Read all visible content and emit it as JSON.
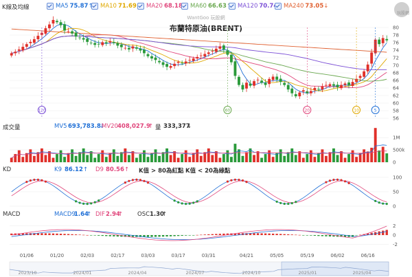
{
  "header": {
    "kline_label": "K線及均線",
    "ma": [
      {
        "name": "MA5",
        "value": "75.87",
        "arrow": "↑",
        "color": "#1f6fd6"
      },
      {
        "name": "MA10",
        "value": "71.69",
        "arrow": "↑",
        "color": "#e0a800"
      },
      {
        "name": "MA20",
        "value": "68.18",
        "arrow": "↑",
        "color": "#e0457b"
      },
      {
        "name": "MA60",
        "value": "66.63",
        "arrow": "↑",
        "color": "#6aa84f"
      },
      {
        "name": "MA120",
        "value": "70.74",
        "arrow": "↑",
        "color": "#7b4fd6"
      },
      {
        "name": "MA240",
        "value": "73.05",
        "arrow": "↓",
        "color": "#e06030"
      }
    ],
    "watermark": "WantGoo 玩股網",
    "title": "布蘭特原油(BRENT)",
    "logo_text": "玩股網"
  },
  "volume": {
    "label": "成交量",
    "mv5_label": "MV5",
    "mv5_value": "693,783.8",
    "mv5_arrow": "↓",
    "mv20_label": "MV20",
    "mv20_value": "408,027.9",
    "mv20_arrow": "↑",
    "vol_label": "量",
    "vol_value": "333,377",
    "vol_arrow": "↓",
    "y_ticks": [
      "1M",
      "500k",
      "0"
    ],
    "colors": {
      "mv5": "#1f6fd6",
      "mv20": "#e0457b"
    }
  },
  "kd": {
    "label": "KD",
    "k_label": "K9",
    "k_value": "86.12",
    "k_arrow": "↑",
    "d_label": "D9",
    "d_value": "80.56",
    "d_arrow": "↑",
    "note1": "K值 > 80為紅點",
    "note2": "K值 < 20為綠點",
    "y_ticks": [
      "100",
      "50",
      "0"
    ],
    "colors": {
      "k": "#1f6fd6",
      "d": "#e0457b"
    }
  },
  "macd": {
    "label": "MACD",
    "macd_label": "MACD9",
    "macd_value": "1.64",
    "macd_arrow": "↑",
    "dif_label": "DIF",
    "dif_value": "2.94",
    "dif_arrow": "↑",
    "osc_label": "OSC",
    "osc_value": "1.30",
    "osc_arrow": "↑",
    "y_ticks": [
      "2",
      "0",
      "-2"
    ],
    "colors": {
      "macd": "#1f6fd6",
      "dif": "#e0457b"
    }
  },
  "price_axis": {
    "ticks": [
      "80",
      "78",
      "76",
      "74",
      "72",
      "70",
      "68",
      "66",
      "64",
      "62",
      "60",
      "58",
      "56"
    ]
  },
  "date_axis": {
    "ticks": [
      "01/06",
      "01/20",
      "02/03",
      "02/17",
      "03/03",
      "03/17",
      "03/31",
      "04/21",
      "05/05",
      "05/19",
      "06/02",
      "06/16"
    ]
  },
  "nav_axis": {
    "ticks": [
      "2023/10",
      "2024/01",
      "2024/04",
      "2024/07",
      "2024/10",
      "2025/01",
      "2025/04"
    ]
  },
  "markers": [
    {
      "text": "120",
      "color": "#7b4fd6"
    },
    {
      "text": "60",
      "color": "#6aa84f"
    },
    {
      "text": "20",
      "color": "#e0457b"
    },
    {
      "text": "10",
      "color": "#e0a800"
    },
    {
      "text": "5",
      "color": "#1f6fd6"
    }
  ],
  "chart_data": {
    "type": "candlestick",
    "title": "布蘭特原油(BRENT)",
    "x": [
      "01/06",
      "01/20",
      "02/03",
      "02/17",
      "03/03",
      "03/17",
      "03/31",
      "04/21",
      "05/05",
      "05/19",
      "06/02",
      "06/16"
    ],
    "ylim": [
      56,
      80
    ],
    "close_approx": [
      73.2,
      73.6,
      74.2,
      74.9,
      75.6,
      76.2,
      76.9,
      77.8,
      78.6,
      79.8,
      80.8,
      82.0,
      81.4,
      80.6,
      79.2,
      79.0,
      78.4,
      77.6,
      77.2,
      76.8,
      76.2,
      75.9,
      75.4,
      75.6,
      76.1,
      75.8,
      76.4,
      75.9,
      75.2,
      74.8,
      74.6,
      74.2,
      75.0,
      74.4,
      73.9,
      73.2,
      72.4,
      71.8,
      71.4,
      70.8,
      70.1,
      69.6,
      69.8,
      70.4,
      70.9,
      70.5,
      71.0,
      71.4,
      71.8,
      72.2,
      72.6,
      73.0,
      73.4,
      73.8,
      74.4,
      75.0,
      74.2,
      72.8,
      70.8,
      67.2,
      64.8,
      63.6,
      65.4,
      64.6,
      65.8,
      66.2,
      65.4,
      64.8,
      66.4,
      67.0,
      66.2,
      65.6,
      64.8,
      63.6,
      62.6,
      61.8,
      62.8,
      63.4,
      62.6,
      63.2,
      64.0,
      63.6,
      64.4,
      64.8,
      65.0,
      64.6,
      64.2,
      64.8,
      65.2,
      64.8,
      65.6,
      66.4,
      67.2,
      68.4,
      70.2,
      73.4,
      76.8,
      75.6,
      77.2,
      76.6
    ],
    "ma_series": [
      "MA5",
      "MA10",
      "MA20",
      "MA60",
      "MA120",
      "MA240"
    ],
    "volume_ylim": [
      0,
      1200000
    ],
    "kd_ylim": [
      0,
      100
    ],
    "macd_ylim": [
      -3,
      3
    ]
  }
}
